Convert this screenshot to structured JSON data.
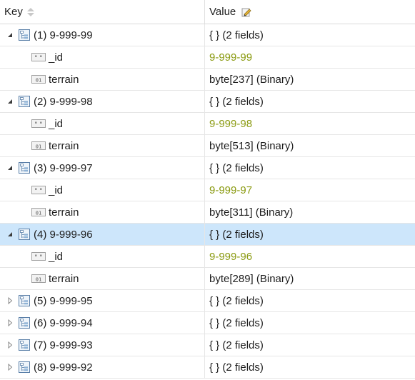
{
  "header": {
    "key_label": "Key",
    "value_label": "Value"
  },
  "rows": [
    {
      "kind": "doc",
      "expanded": true,
      "selected": false,
      "key": "(1) 9-999-99",
      "value": "{ } (2 fields)"
    },
    {
      "kind": "string",
      "key": "_id",
      "value": "9-999-99"
    },
    {
      "kind": "binary",
      "key": "terrain",
      "value": "byte[237] (Binary)"
    },
    {
      "kind": "doc",
      "expanded": true,
      "selected": false,
      "key": "(2) 9-999-98",
      "value": "{ } (2 fields)"
    },
    {
      "kind": "string",
      "key": "_id",
      "value": "9-999-98"
    },
    {
      "kind": "binary",
      "key": "terrain",
      "value": "byte[513] (Binary)"
    },
    {
      "kind": "doc",
      "expanded": true,
      "selected": false,
      "key": "(3) 9-999-97",
      "value": "{ } (2 fields)"
    },
    {
      "kind": "string",
      "key": "_id",
      "value": "9-999-97"
    },
    {
      "kind": "binary",
      "key": "terrain",
      "value": "byte[311] (Binary)"
    },
    {
      "kind": "doc",
      "expanded": true,
      "selected": true,
      "key": "(4) 9-999-96",
      "value": "{ } (2 fields)"
    },
    {
      "kind": "string",
      "key": "_id",
      "value": "9-999-96"
    },
    {
      "kind": "binary",
      "key": "terrain",
      "value": "byte[289] (Binary)"
    },
    {
      "kind": "doc",
      "expanded": false,
      "selected": false,
      "key": "(5) 9-999-95",
      "value": "{ } (2 fields)"
    },
    {
      "kind": "doc",
      "expanded": false,
      "selected": false,
      "key": "(6) 9-999-94",
      "value": "{ } (2 fields)"
    },
    {
      "kind": "doc",
      "expanded": false,
      "selected": false,
      "key": "(7) 9-999-93",
      "value": "{ } (2 fields)"
    },
    {
      "kind": "doc",
      "expanded": false,
      "selected": false,
      "key": "(8) 9-999-92",
      "value": "{ } (2 fields)"
    }
  ],
  "colors": {
    "selected_row": "#cde6fb",
    "id_value": "#8a9a10"
  },
  "icons": {
    "document": "document-tree-icon",
    "string": "string-field-icon",
    "binary": "binary-field-icon",
    "sort": "sort-arrows-icon",
    "edit": "edit-pencil-icon"
  }
}
